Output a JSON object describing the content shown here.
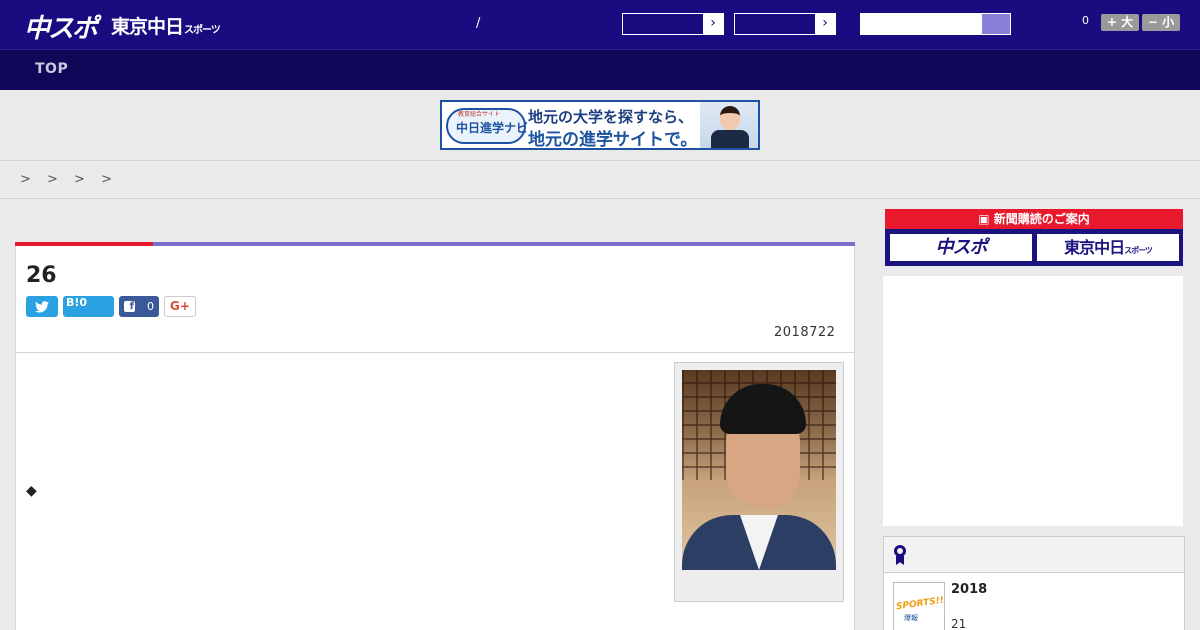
{
  "header": {
    "logo_chuspo": "中スポ",
    "logo_tokyo": "東京中日",
    "logo_tokyo_suffix": "スポーツ",
    "slash": "/",
    "select1_arrow": "›",
    "select2_arrow": "›",
    "search_value": "",
    "font_count": "0",
    "font_large_label": "+ 大",
    "font_small_label": "− 小"
  },
  "nav": {
    "items": [
      {
        "label": "TOP"
      }
    ]
  },
  "banner": {
    "logo_small": "教育総合サイト",
    "logo_main": "中日進学ナビ",
    "line1": "地元の大学を探すなら、",
    "line2": "地元の進学サイトで。"
  },
  "breadcrumb": "> > > >",
  "article": {
    "title": "26",
    "hatena_label": "B!0",
    "facebook_icon": "f",
    "facebook_count": "0",
    "gplus_label": "G+",
    "date": "2018722",
    "body_marker": "◆"
  },
  "sidebar": {
    "subscribe_heading": "新聞購読のご案内",
    "subscribe_chuspo": "中スポ",
    "subscribe_tokyo": "東京中日",
    "subscribe_tokyo_suffix": "スポーツ",
    "ranking_thumb_text": "SPORTS!!",
    "ranking_thumb_sub": "爆報",
    "ranking_year": "2018",
    "ranking_sub": "21"
  },
  "colors": {
    "header_bg": "#190b80",
    "nav_bg": "#0f0758",
    "accent_red": "#e8192c",
    "accent_purple": "#7a6fc8",
    "twitter": "#2aa1e0",
    "facebook": "#3b5998"
  },
  "icons": [
    "twitter-icon",
    "hatena-bookmark-icon",
    "facebook-icon",
    "google-plus-icon",
    "search-icon",
    "chevron-right-icon",
    "ranking-badge-icon",
    "newspaper-icon"
  ]
}
